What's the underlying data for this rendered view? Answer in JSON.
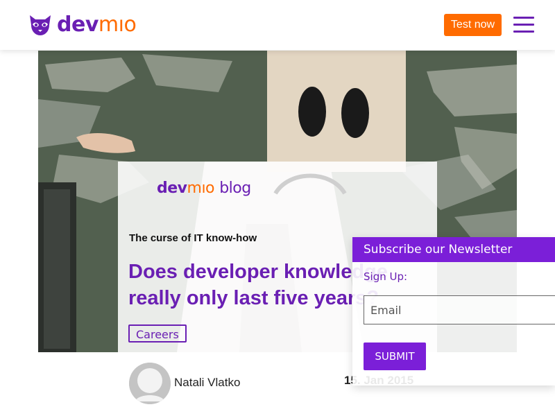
{
  "header": {
    "logo": {
      "dev": "dev",
      "mio": "mıo"
    },
    "test_button": "Test now",
    "menu_icon": "hamburger-menu-icon"
  },
  "hero": {
    "image": "paper-bag-sad-face-photo"
  },
  "article": {
    "blog_logo": {
      "dev": "dev",
      "mio": "mıo",
      "blog": "blog"
    },
    "kicker": "The curse of IT know-how",
    "headline": "Does developer knowledge really only last five years?",
    "tag": "Careers",
    "author": "Natali Vlatko",
    "date": "15. Jan 2015",
    "avatar_icon": "user-avatar-icon"
  },
  "newsletter": {
    "title": "Subscribe our Newsletter",
    "signup_label": "Sign Up:",
    "email_placeholder": "Email",
    "submit_label": "SUBMIT"
  },
  "colors": {
    "brand_purple": "#6a1fb3",
    "brand_orange": "#ff6b00",
    "newsletter_purple": "#7b1fd8"
  }
}
